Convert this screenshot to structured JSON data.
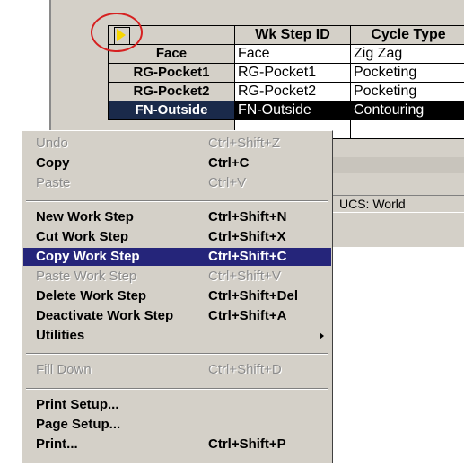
{
  "grid": {
    "columns": [
      "Wk Step ID",
      "Cycle Type"
    ],
    "rows": [
      {
        "header": "Face",
        "id": "Face",
        "type": "Zig Zag"
      },
      {
        "header": "RG-Pocket1",
        "id": "RG-Pocket1",
        "type": "Pocketing"
      },
      {
        "header": "RG-Pocket2",
        "id": "RG-Pocket2",
        "type": "Pocketing"
      },
      {
        "header": "FN-Outside",
        "id": "FN-Outside",
        "type": "Contouring"
      }
    ]
  },
  "status_bar": {
    "ucs": "UCS: World"
  },
  "context_menu": {
    "items": [
      {
        "label": "Undo",
        "shortcut": "Ctrl+Shift+Z",
        "state": "disabled"
      },
      {
        "label": "Copy",
        "shortcut": "Ctrl+C",
        "state": "enabled"
      },
      {
        "label": "Paste",
        "shortcut": "Ctrl+V",
        "state": "disabled"
      },
      {
        "label": "New Work Step",
        "shortcut": "Ctrl+Shift+N",
        "state": "enabled"
      },
      {
        "label": "Cut Work Step",
        "shortcut": "Ctrl+Shift+X",
        "state": "enabled"
      },
      {
        "label": "Copy Work Step",
        "shortcut": "Ctrl+Shift+C",
        "state": "highlighted"
      },
      {
        "label": "Paste Work Step",
        "shortcut": "Ctrl+Shift+V",
        "state": "disabled"
      },
      {
        "label": "Delete Work Step",
        "shortcut": "Ctrl+Shift+Del",
        "state": "enabled"
      },
      {
        "label": "Deactivate Work Step",
        "shortcut": "Ctrl+Shift+A",
        "state": "enabled"
      },
      {
        "label": "Utilities",
        "shortcut": "",
        "state": "submenu"
      },
      {
        "label": "Fill Down",
        "shortcut": "Ctrl+Shift+D",
        "state": "disabled"
      },
      {
        "label": "Print Setup...",
        "shortcut": "",
        "state": "enabled"
      },
      {
        "label": "Page Setup...",
        "shortcut": "",
        "state": "enabled"
      },
      {
        "label": "Print...",
        "shortcut": "Ctrl+Shift+P",
        "state": "enabled"
      }
    ]
  },
  "colors": {
    "highlight": "#25257a",
    "annotation_circle": "#d62020",
    "corner_arrow": "#f6d600"
  }
}
